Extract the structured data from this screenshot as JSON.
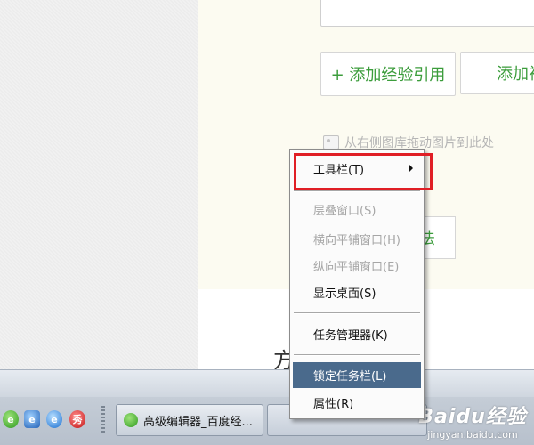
{
  "editor": {
    "add_reference_button": "+ 添加经验引用",
    "add_second_button": "添加视",
    "method_button_partial": "法",
    "drag_hint": "从右侧图库拖动图片到此处",
    "partial_text": "方"
  },
  "context_menu": {
    "items": [
      {
        "label": "工具栏(T)",
        "enabled": true,
        "submenu": true
      },
      {
        "label": "层叠窗口(S)",
        "enabled": false
      },
      {
        "label": "横向平铺窗口(H)",
        "enabled": false
      },
      {
        "label": "纵向平铺窗口(E)",
        "enabled": false
      },
      {
        "label": "显示桌面(S)",
        "enabled": true
      },
      {
        "label": "任务管理器(K)",
        "enabled": true
      },
      {
        "label": "锁定任务栏(L)",
        "enabled": true,
        "selected": true
      },
      {
        "label": "属性(R)",
        "enabled": true
      }
    ],
    "highlight_color": "#e01e25"
  },
  "taskbar": {
    "quicklaunch": [
      {
        "icon": "green-e-icon",
        "glyph": "e"
      },
      {
        "icon": "blue-e-icon",
        "glyph": "e"
      },
      {
        "icon": "ie-icon",
        "glyph": "e"
      },
      {
        "icon": "red-show-icon",
        "glyph": "秀"
      }
    ],
    "active_task": "高级编辑器_百度经..."
  },
  "watermark": {
    "logo": "Baidu经验",
    "url": "jingyan.baidu.com"
  }
}
